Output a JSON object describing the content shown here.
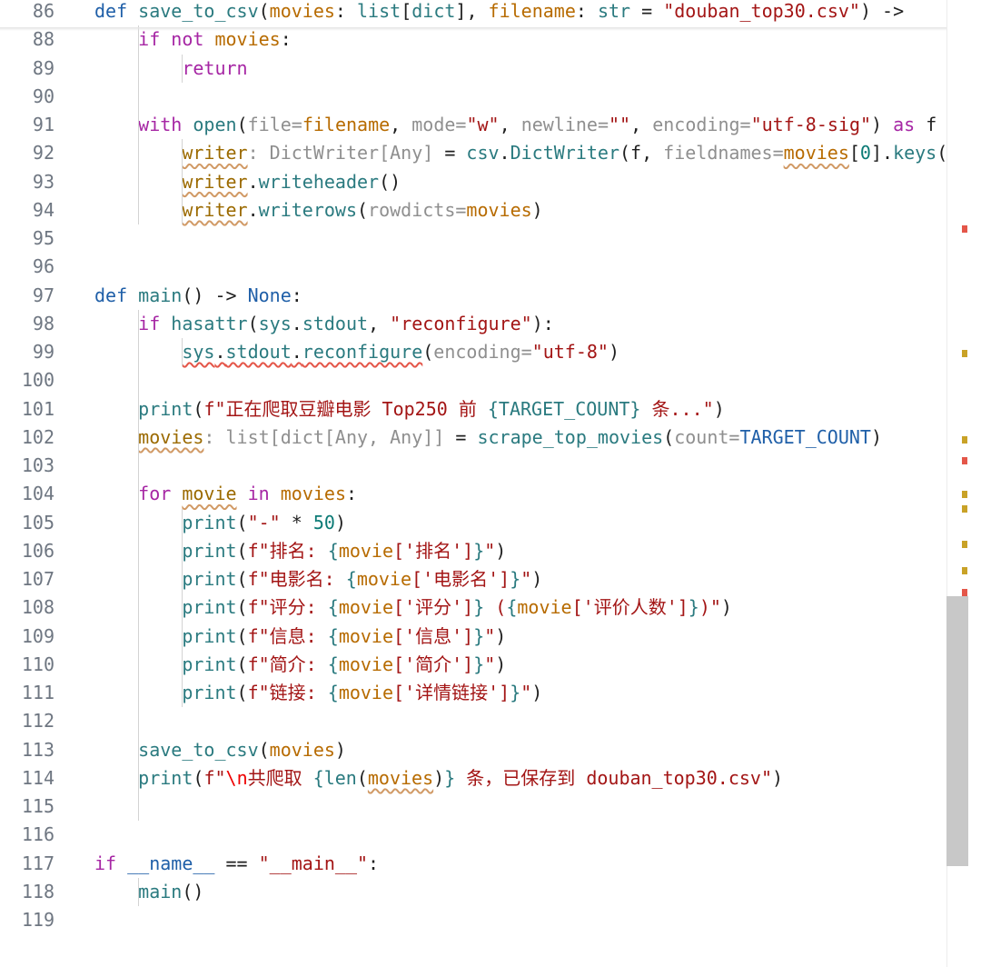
{
  "lines": [
    {
      "n": "86",
      "segments": [
        [
          "def",
          "def "
        ],
        [
          "fn",
          "save_to_csv"
        ],
        [
          "op",
          "("
        ],
        [
          "par",
          "movies"
        ],
        [
          "op",
          ": "
        ],
        [
          "ty",
          "list"
        ],
        [
          "op",
          "["
        ],
        [
          "ty",
          "dict"
        ],
        [
          "op",
          "], "
        ],
        [
          "par",
          "filename"
        ],
        [
          "op",
          ": "
        ],
        [
          "ty",
          "str"
        ],
        [
          "op",
          " = "
        ],
        [
          "str",
          "\"douban_top30.csv\""
        ],
        [
          "op",
          ") ->"
        ]
      ]
    },
    {
      "n": "88",
      "segments": [
        [
          "op",
          "    "
        ],
        [
          "kw",
          "if not "
        ],
        [
          "par",
          "movies"
        ],
        [
          "op",
          ":"
        ]
      ]
    },
    {
      "n": "89",
      "segments": [
        [
          "op",
          "        "
        ],
        [
          "kw",
          "return"
        ]
      ]
    },
    {
      "n": "90",
      "segments": []
    },
    {
      "n": "91",
      "segments": [
        [
          "op",
          "    "
        ],
        [
          "kw",
          "with "
        ],
        [
          "fn",
          "open"
        ],
        [
          "op",
          "("
        ],
        [
          "hint",
          "file="
        ],
        [
          "par",
          "filename"
        ],
        [
          "op",
          ", "
        ],
        [
          "hint",
          "mode="
        ],
        [
          "str",
          "\"w\""
        ],
        [
          "op",
          ", "
        ],
        [
          "hint",
          "newline="
        ],
        [
          "str",
          "\"\""
        ],
        [
          "op",
          ", "
        ],
        [
          "hint",
          "encoding="
        ],
        [
          "str",
          "\"utf-8-sig\""
        ],
        [
          "op",
          ") "
        ],
        [
          "kw",
          "as "
        ],
        [
          "op",
          "f"
        ]
      ]
    },
    {
      "n": "92",
      "segments": [
        [
          "op",
          "        "
        ],
        [
          "var wavy",
          "writer"
        ],
        [
          "hint",
          ": DictWriter[Any]"
        ],
        [
          "op",
          " = "
        ],
        [
          "fn",
          "csv"
        ],
        [
          "op",
          "."
        ],
        [
          "fn",
          "DictWriter"
        ],
        [
          "op",
          "(f, "
        ],
        [
          "hint",
          "fieldnames="
        ],
        [
          "par wavy",
          "movies"
        ],
        [
          "op",
          "["
        ],
        [
          "num",
          "0"
        ],
        [
          "op",
          "]."
        ],
        [
          "fn",
          "keys"
        ],
        [
          "op",
          "())"
        ]
      ]
    },
    {
      "n": "93",
      "segments": [
        [
          "op",
          "        "
        ],
        [
          "var wavy",
          "writer"
        ],
        [
          "op",
          "."
        ],
        [
          "fn",
          "writeheader"
        ],
        [
          "op",
          "()"
        ]
      ]
    },
    {
      "n": "94",
      "segments": [
        [
          "op",
          "        "
        ],
        [
          "var wavy",
          "writer"
        ],
        [
          "op",
          "."
        ],
        [
          "fn",
          "writerows"
        ],
        [
          "op",
          "("
        ],
        [
          "hint",
          "rowdicts="
        ],
        [
          "par",
          "movies"
        ],
        [
          "op",
          ")"
        ]
      ]
    },
    {
      "n": "95",
      "segments": []
    },
    {
      "n": "96",
      "segments": []
    },
    {
      "n": "97",
      "segments": [
        [
          "def",
          "def "
        ],
        [
          "fn",
          "main"
        ],
        [
          "op",
          "() -> "
        ],
        [
          "const",
          "None"
        ],
        [
          "op",
          ":"
        ]
      ]
    },
    {
      "n": "98",
      "segments": [
        [
          "op",
          "    "
        ],
        [
          "kw",
          "if "
        ],
        [
          "fn",
          "hasattr"
        ],
        [
          "op",
          "("
        ],
        [
          "fn",
          "sys"
        ],
        [
          "op",
          "."
        ],
        [
          "fn",
          "stdout"
        ],
        [
          "op",
          ", "
        ],
        [
          "str",
          "\"reconfigure\""
        ],
        [
          "op",
          "):"
        ]
      ]
    },
    {
      "n": "99",
      "segments": [
        [
          "op",
          "        "
        ],
        [
          "fn wavyr",
          "sys"
        ],
        [
          "op wavyr",
          "."
        ],
        [
          "fn wavyr",
          "stdout"
        ],
        [
          "op wavyr",
          "."
        ],
        [
          "fn wavyr",
          "reconfigure"
        ],
        [
          "op",
          "("
        ],
        [
          "hint",
          "encoding="
        ],
        [
          "str",
          "\"utf-8\""
        ],
        [
          "op",
          ")"
        ]
      ]
    },
    {
      "n": "100",
      "segments": []
    },
    {
      "n": "101",
      "segments": [
        [
          "op",
          "    "
        ],
        [
          "fn",
          "print"
        ],
        [
          "op",
          "("
        ],
        [
          "str",
          "f\"正在爬取豆瓣电影 Top250 前 "
        ],
        [
          "ty",
          "{TARGET_COUNT}"
        ],
        [
          "str",
          " 条...\""
        ],
        [
          "op",
          ")"
        ]
      ]
    },
    {
      "n": "102",
      "segments": [
        [
          "op",
          "    "
        ],
        [
          "var wavy",
          "movies"
        ],
        [
          "hint",
          ": list[dict[Any, Any]]"
        ],
        [
          "op",
          " = "
        ],
        [
          "fn",
          "scrape_top_movies"
        ],
        [
          "op",
          "("
        ],
        [
          "hint",
          "count="
        ],
        [
          "const",
          "TARGET_COUNT"
        ],
        [
          "op",
          ")"
        ]
      ]
    },
    {
      "n": "103",
      "segments": []
    },
    {
      "n": "104",
      "segments": [
        [
          "op",
          "    "
        ],
        [
          "kw",
          "for "
        ],
        [
          "var wavy",
          "movie"
        ],
        [
          "kw",
          " in "
        ],
        [
          "par",
          "movies"
        ],
        [
          "op",
          ":"
        ]
      ]
    },
    {
      "n": "105",
      "segments": [
        [
          "op",
          "        "
        ],
        [
          "fn",
          "print"
        ],
        [
          "op",
          "("
        ],
        [
          "str",
          "\"-\""
        ],
        [
          "op",
          " * "
        ],
        [
          "num",
          "50"
        ],
        [
          "op",
          ")"
        ]
      ]
    },
    {
      "n": "106",
      "segments": [
        [
          "op",
          "        "
        ],
        [
          "fn",
          "print"
        ],
        [
          "op",
          "("
        ],
        [
          "str",
          "f\"排名: "
        ],
        [
          "ty",
          "{"
        ],
        [
          "par",
          "movie"
        ],
        [
          "str",
          "['排名']"
        ],
        [
          "ty",
          "}"
        ],
        [
          "str",
          "\""
        ],
        [
          "op",
          ")"
        ]
      ]
    },
    {
      "n": "107",
      "segments": [
        [
          "op",
          "        "
        ],
        [
          "fn",
          "print"
        ],
        [
          "op",
          "("
        ],
        [
          "str",
          "f\"电影名: "
        ],
        [
          "ty",
          "{"
        ],
        [
          "par",
          "movie"
        ],
        [
          "str",
          "['电影名']"
        ],
        [
          "ty",
          "}"
        ],
        [
          "str",
          "\""
        ],
        [
          "op",
          ")"
        ]
      ]
    },
    {
      "n": "108",
      "segments": [
        [
          "op",
          "        "
        ],
        [
          "fn",
          "print"
        ],
        [
          "op",
          "("
        ],
        [
          "str",
          "f\"评分: "
        ],
        [
          "ty",
          "{"
        ],
        [
          "par",
          "movie"
        ],
        [
          "str",
          "['评分']"
        ],
        [
          "ty",
          "}"
        ],
        [
          "str",
          " ("
        ],
        [
          "ty",
          "{"
        ],
        [
          "par",
          "movie"
        ],
        [
          "str",
          "['评价人数']"
        ],
        [
          "ty",
          "}"
        ],
        [
          "str",
          ")\""
        ],
        [
          "op",
          ")"
        ]
      ]
    },
    {
      "n": "109",
      "segments": [
        [
          "op",
          "        "
        ],
        [
          "fn",
          "print"
        ],
        [
          "op",
          "("
        ],
        [
          "str",
          "f\"信息: "
        ],
        [
          "ty",
          "{"
        ],
        [
          "par",
          "movie"
        ],
        [
          "str",
          "['信息']"
        ],
        [
          "ty",
          "}"
        ],
        [
          "str",
          "\""
        ],
        [
          "op",
          ")"
        ]
      ]
    },
    {
      "n": "110",
      "segments": [
        [
          "op",
          "        "
        ],
        [
          "fn",
          "print"
        ],
        [
          "op",
          "("
        ],
        [
          "str",
          "f\"简介: "
        ],
        [
          "ty",
          "{"
        ],
        [
          "par",
          "movie"
        ],
        [
          "str",
          "['简介']"
        ],
        [
          "ty",
          "}"
        ],
        [
          "str",
          "\""
        ],
        [
          "op",
          ")"
        ]
      ]
    },
    {
      "n": "111",
      "segments": [
        [
          "op",
          "        "
        ],
        [
          "fn",
          "print"
        ],
        [
          "op",
          "("
        ],
        [
          "str",
          "f\"链接: "
        ],
        [
          "ty",
          "{"
        ],
        [
          "par",
          "movie"
        ],
        [
          "str",
          "['详情链接']"
        ],
        [
          "ty",
          "}"
        ],
        [
          "str",
          "\""
        ],
        [
          "op",
          ")"
        ]
      ]
    },
    {
      "n": "112",
      "segments": []
    },
    {
      "n": "113",
      "segments": [
        [
          "op",
          "    "
        ],
        [
          "fn",
          "save_to_csv"
        ],
        [
          "op",
          "("
        ],
        [
          "par",
          "movies"
        ],
        [
          "op",
          ")"
        ]
      ]
    },
    {
      "n": "114",
      "segments": [
        [
          "op",
          "    "
        ],
        [
          "fn",
          "print"
        ],
        [
          "op",
          "("
        ],
        [
          "str",
          "f\""
        ],
        [
          "esc",
          "\\n"
        ],
        [
          "str",
          "共爬取 "
        ],
        [
          "ty",
          "{"
        ],
        [
          "fn",
          "len"
        ],
        [
          "op",
          "("
        ],
        [
          "par wavy",
          "movies"
        ],
        [
          "op",
          ")"
        ],
        [
          "ty",
          "}"
        ],
        [
          "str",
          " 条，已保存到 douban_top30.csv\""
        ],
        [
          "op",
          ")"
        ]
      ]
    },
    {
      "n": "115",
      "segments": []
    },
    {
      "n": "116",
      "segments": []
    },
    {
      "n": "117",
      "segments": [
        [
          "kw",
          "if "
        ],
        [
          "const",
          "__name__"
        ],
        [
          "op",
          " == "
        ],
        [
          "str",
          "\"__main__\""
        ],
        [
          "op",
          ":"
        ]
      ]
    },
    {
      "n": "118",
      "segments": [
        [
          "op",
          "    "
        ],
        [
          "fn",
          "main"
        ],
        [
          "op",
          "()"
        ]
      ]
    },
    {
      "n": "119",
      "segments": []
    }
  ],
  "colors": {
    "warning_marker": "#c9a227",
    "error_marker": "#e45649",
    "scroll_thumb": "#c8c8c8"
  }
}
